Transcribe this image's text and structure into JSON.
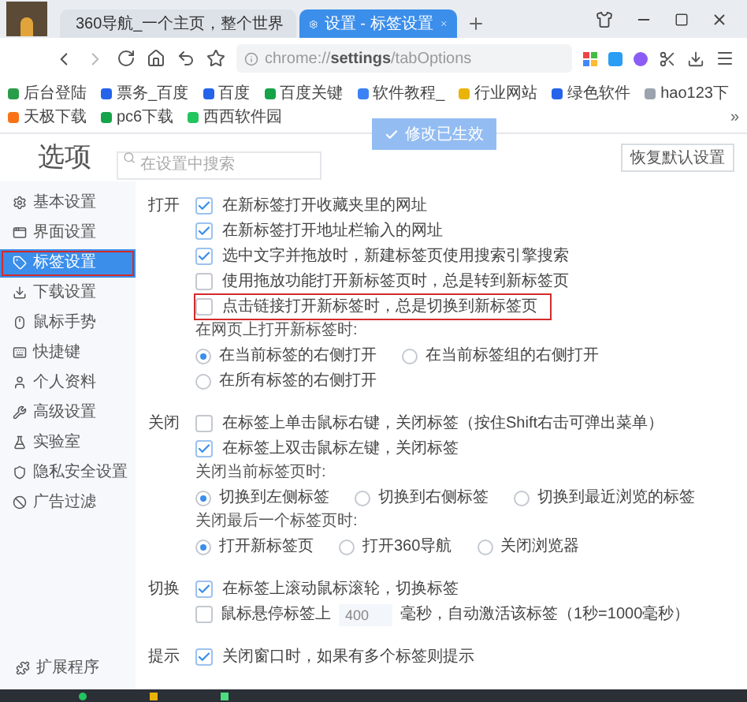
{
  "tabs": [
    {
      "label": "360导航_一个主页，整个世界",
      "selected": false
    },
    {
      "label": "设置 - 标签设置",
      "selected": true
    }
  ],
  "address": {
    "prefix": "chrome://",
    "bold": "settings",
    "rest": "/tabOptions"
  },
  "bookmarks": [
    "后台登陆",
    "票务_百度",
    "百度",
    "百度关键",
    "软件教程_",
    "行业网站",
    "绿色软件",
    "hao123下",
    "天极下载",
    "pc6下载",
    "西西软件园"
  ],
  "bookmarks_more": "»",
  "header": {
    "title": "选项",
    "search_placeholder": "在设置中搜索",
    "toast": "修改已生效",
    "reset_button": "恢复默认设置"
  },
  "sidebar": {
    "items": [
      {
        "label": "基本设置",
        "selected": false,
        "outlined": false
      },
      {
        "label": "界面设置",
        "selected": false,
        "outlined": false
      },
      {
        "label": "标签设置",
        "selected": true,
        "outlined": true
      },
      {
        "label": "下载设置",
        "selected": false,
        "outlined": false
      },
      {
        "label": "鼠标手势",
        "selected": false,
        "outlined": false
      },
      {
        "label": "快捷键",
        "selected": false,
        "outlined": false
      },
      {
        "label": "个人资料",
        "selected": false,
        "outlined": false
      },
      {
        "label": "高级设置",
        "selected": false,
        "outlined": false
      },
      {
        "label": "实验室",
        "selected": false,
        "outlined": false
      },
      {
        "label": "隐私安全设置",
        "selected": false,
        "outlined": false
      },
      {
        "label": "广告过滤",
        "selected": false,
        "outlined": false
      }
    ],
    "footer": "扩展程序"
  },
  "sections": [
    {
      "title": "打开",
      "items": [
        {
          "kind": "checkbox",
          "label": "在新标签打开收藏夹里的网址",
          "checked": true,
          "outlined": false
        },
        {
          "kind": "checkbox",
          "label": "在新标签打开地址栏输入的网址",
          "checked": true,
          "outlined": false
        },
        {
          "kind": "checkbox",
          "label": "选中文字并拖放时，新建标签页使用搜索引擎搜索",
          "checked": true,
          "outlined": false
        },
        {
          "kind": "checkbox",
          "label": "使用拖放功能打开新标签页时，总是转到新标签页",
          "checked": false,
          "outlined": false
        },
        {
          "kind": "checkbox",
          "label": "点击链接打开新标签时，总是切换到新标签页",
          "checked": false,
          "outlined": true
        },
        {
          "kind": "caption",
          "label": "在网页上打开新标签时:"
        },
        {
          "kind": "radio",
          "options": [
            {
              "label": "在当前标签的右侧打开",
              "selected": true
            },
            {
              "label": "在当前标签组的右侧打开",
              "selected": false
            },
            {
              "label": "在所有标签的右侧打开",
              "selected": false
            }
          ]
        }
      ]
    },
    {
      "title": "关闭",
      "items": [
        {
          "kind": "checkbox",
          "label": "在标签上单击鼠标右键，关闭标签（按住Shift右击可弹出菜单）",
          "checked": false,
          "outlined": false
        },
        {
          "kind": "checkbox",
          "label": "在标签上双击鼠标左键，关闭标签",
          "checked": true,
          "outlined": false
        },
        {
          "kind": "caption",
          "label": "关闭当前标签页时:"
        },
        {
          "kind": "radio",
          "options": [
            {
              "label": "切换到左侧标签",
              "selected": true
            },
            {
              "label": "切换到右侧标签",
              "selected": false
            },
            {
              "label": "切换到最近浏览的标签",
              "selected": false
            }
          ]
        },
        {
          "kind": "caption",
          "label": "关闭最后一个标签页时:"
        },
        {
          "kind": "radio",
          "options": [
            {
              "label": "打开新标签页",
              "selected": true
            },
            {
              "label": "打开360导航",
              "selected": false
            },
            {
              "label": "关闭浏览器",
              "selected": false
            }
          ]
        }
      ]
    },
    {
      "title": "切换",
      "items": [
        {
          "kind": "checkbox",
          "label": "在标签上滚动鼠标滚轮，切换标签",
          "checked": true,
          "outlined": false
        },
        {
          "kind": "hover_delay",
          "before": "鼠标悬停标签上",
          "value": "400",
          "after": "毫秒，自动激活该标签（1秒=1000毫秒）",
          "checked": false
        }
      ]
    },
    {
      "title": "提示",
      "items": [
        {
          "kind": "checkbox",
          "label": "关闭窗口时，如果有多个标签则提示",
          "checked": true,
          "outlined": false
        }
      ]
    }
  ]
}
